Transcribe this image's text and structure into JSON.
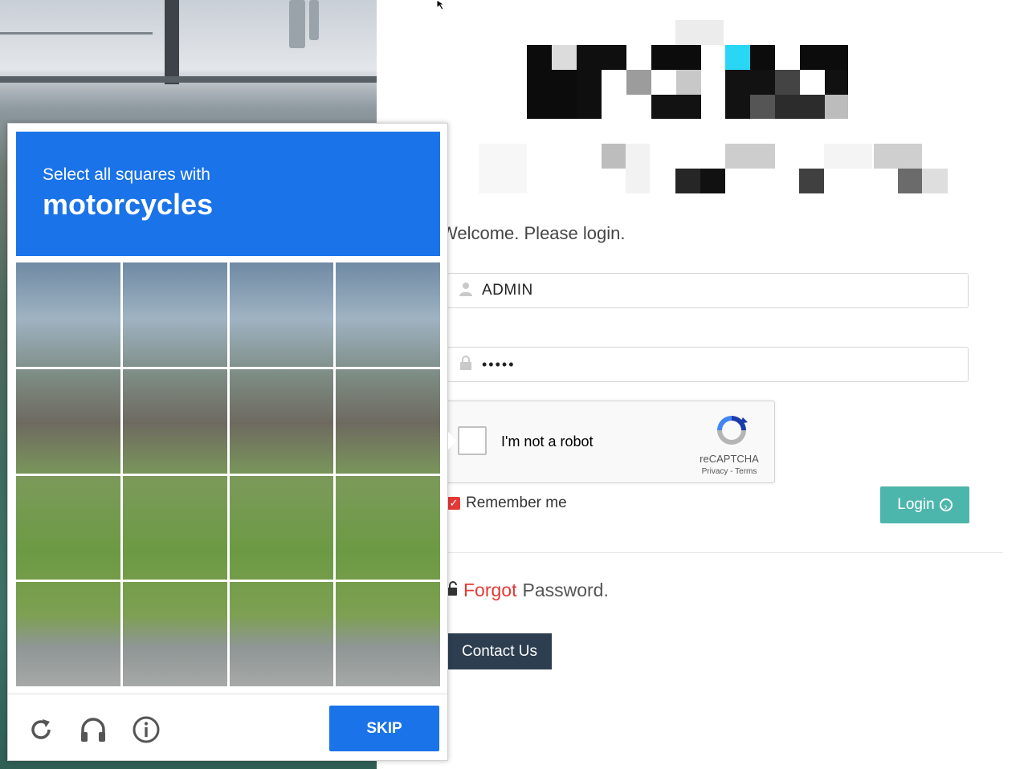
{
  "login": {
    "welcome": "Welcome. Please login.",
    "username_value": "ADMIN",
    "password_value": "•••••",
    "remember_label": "Remember me",
    "remember_checked": true,
    "login_label": "Login",
    "forgot_red": "Forgot",
    "forgot_rest": "Password.",
    "contact_label": "Contact Us"
  },
  "recaptcha": {
    "checkbox_label": "I'm not a robot",
    "brand": "reCAPTCHA",
    "links": "Privacy - Terms"
  },
  "challenge": {
    "instruction_line1": "Select all squares with",
    "instruction_target": "motorcycles",
    "skip_label": "SKIP",
    "grid_rows": 4,
    "grid_cols": 4,
    "footer_icons": [
      "reload-icon",
      "audio-headphones-icon",
      "info-icon"
    ]
  },
  "colors": {
    "challenge_blue": "#1a73e8",
    "login_teal": "#4db6ac",
    "contact_navy": "#2d3e50",
    "forgot_red": "#e53935"
  }
}
